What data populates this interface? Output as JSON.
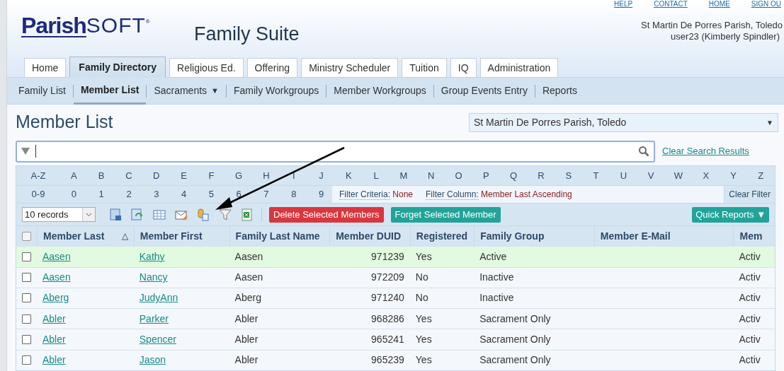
{
  "logo": {
    "main": "Parish",
    "suffix": "SOFT",
    "mark": "®"
  },
  "app_title": "Family Suite",
  "top_links": [
    "HELP",
    "CONTACT",
    "HOME",
    "SIGN OU"
  ],
  "parish_name": "St Martin De Porres Parish, Toledo",
  "user": "user23 (Kimberly Spindler)",
  "tabs": [
    {
      "label": "Home",
      "selected": false
    },
    {
      "label": "Family Directory",
      "selected": true
    },
    {
      "label": "Religious Ed.",
      "selected": false
    },
    {
      "label": "Offering",
      "selected": false
    },
    {
      "label": "Ministry Scheduler",
      "selected": false
    },
    {
      "label": "Tuition",
      "selected": false
    },
    {
      "label": "IQ",
      "selected": false
    },
    {
      "label": "Administration",
      "selected": false
    }
  ],
  "subnav": [
    {
      "label": "Family List",
      "selected": false,
      "dropdown": false
    },
    {
      "label": "Member List",
      "selected": true,
      "dropdown": false
    },
    {
      "label": "Sacraments",
      "selected": false,
      "dropdown": "▼"
    },
    {
      "label": "Family Workgroups",
      "selected": false,
      "dropdown": false
    },
    {
      "label": "Member Workgroups",
      "selected": false,
      "dropdown": false
    },
    {
      "label": "Group Events Entry",
      "selected": false,
      "dropdown": false
    },
    {
      "label": "Reports",
      "selected": false,
      "dropdown": false
    }
  ],
  "page_title": "Member List",
  "parish_select": "St Martin De Porres Parish, Toledo",
  "parish_select_arrow": "▼",
  "clear_search": "Clear Search Results",
  "letters": [
    "A-Z",
    "A",
    "B",
    "C",
    "D",
    "E",
    "F",
    "G",
    "H",
    "I",
    "J",
    "K",
    "L",
    "M",
    "N",
    "O",
    "P",
    "Q",
    "R",
    "S",
    "T",
    "U",
    "V",
    "W",
    "X",
    "Y",
    "Z"
  ],
  "digits": [
    "0-9",
    "0",
    "1",
    "2",
    "3",
    "4",
    "5",
    "6",
    "7",
    "8",
    "9"
  ],
  "filter_criteria": {
    "label": "Filter Criteria:",
    "value": "None"
  },
  "filter_column": {
    "label": "Filter Column:",
    "value": "Member Last Ascending"
  },
  "clear_filter": "Clear Filter",
  "records_select": "10 records",
  "delete_button": "Delete Selected Members",
  "forget_button": "Forget Selected Member",
  "quick_reports": "Quick Reports ▼",
  "table": {
    "all_checked": false,
    "columns": [
      {
        "label": "Member Last",
        "sorted": true
      },
      {
        "label": "Member First",
        "sorted": false
      },
      {
        "label": "Family Last Name",
        "sorted": false
      },
      {
        "label": "Member DUID",
        "sorted": false
      },
      {
        "label": "Registered",
        "sorted": false
      },
      {
        "label": "Family Group",
        "sorted": false
      },
      {
        "label": "Member E-Mail",
        "sorted": false
      },
      {
        "label": "Mem",
        "sorted": false
      }
    ],
    "sort_mark": "△",
    "rows": [
      {
        "selected": true,
        "checked": false,
        "cells": [
          "Aasen",
          "Kathy",
          "Aasen",
          "971239",
          "Yes",
          "Active",
          "",
          "Activ"
        ]
      },
      {
        "selected": false,
        "checked": false,
        "cells": [
          "Aasen",
          "Nancy",
          "Aasen",
          "972209",
          "No",
          "Inactive",
          "",
          "Activ"
        ]
      },
      {
        "selected": false,
        "checked": false,
        "cells": [
          "Aberg",
          "JudyAnn",
          "Aberg",
          "971240",
          "No",
          "Inactive",
          "",
          "Activ"
        ]
      },
      {
        "selected": false,
        "checked": false,
        "cells": [
          "Abler",
          "Parker",
          "Abler",
          "968286",
          "Yes",
          "Sacrament Only",
          "",
          "Activ"
        ]
      },
      {
        "selected": false,
        "checked": false,
        "cells": [
          "Abler",
          "Spencer",
          "Abler",
          "965241",
          "Yes",
          "Sacrament Only",
          "",
          "Activ"
        ]
      },
      {
        "selected": false,
        "checked": false,
        "cells": [
          "Abler",
          "Jason",
          "Abler",
          "965239",
          "Yes",
          "Sacrament Only",
          "",
          "Activ"
        ]
      }
    ]
  }
}
